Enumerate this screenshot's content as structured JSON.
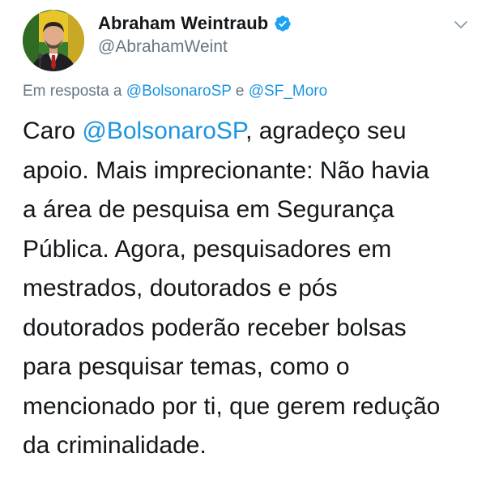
{
  "author": {
    "display_name": "Abraham Weintraub",
    "handle": "@AbrahamWeint",
    "verified": true
  },
  "reply_context": {
    "prefix": "Em resposta a ",
    "mention_1": "@BolsonaroSP",
    "joiner": " e ",
    "mention_2": "@SF_Moro"
  },
  "tweet": {
    "line1_a": "Caro ",
    "line1_mention": "@BolsonaroSP",
    "line1_b": ", agradeço seu",
    "lines": [
      "apoio. Mais imprecionante: Não havia",
      "a área de pesquisa em Segurança",
      "Pública. Agora, pesquisadores em",
      "mestrados, doutorados e pós",
      "doutorados poderão receber bolsas",
      "para pesquisar temas, como o",
      "mencionado por ti, que gerem redução",
      "da criminalidade."
    ]
  },
  "icons": {
    "verified": "verified-badge-icon",
    "menu": "chevron-down-icon"
  },
  "colors": {
    "link": "#1b95e0",
    "muted": "#657786",
    "text": "#14171a",
    "verified": "#1da1f2"
  }
}
